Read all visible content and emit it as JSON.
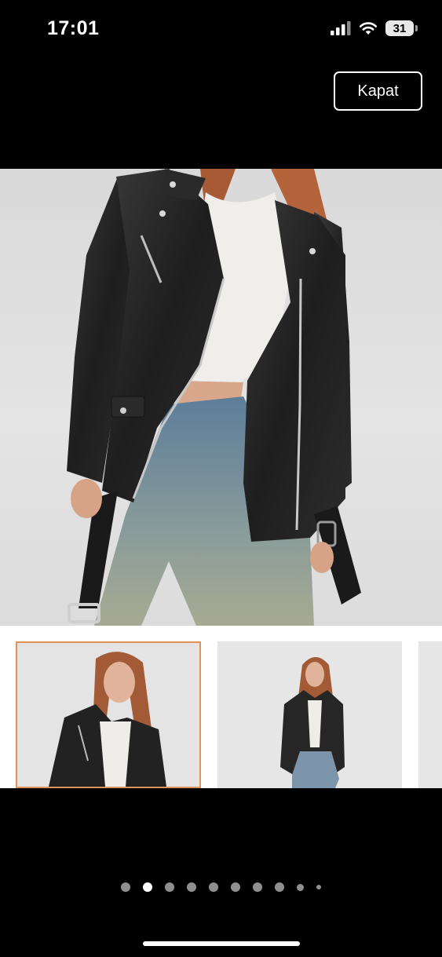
{
  "status_bar": {
    "time": "17:01",
    "battery_level": "31",
    "icons": [
      "cellular-signal-icon",
      "wifi-icon",
      "battery-icon"
    ]
  },
  "close_button": {
    "label": "Kapat"
  },
  "gallery": {
    "main_image": {
      "description_icon": "product-photo-leather-jacket"
    },
    "thumbnails": [
      {
        "name": "thumbnail-1",
        "selected": true
      },
      {
        "name": "thumbnail-2",
        "selected": false
      },
      {
        "name": "thumbnail-3",
        "selected": false
      }
    ],
    "page_count": 10,
    "active_page": 2
  },
  "colors": {
    "background": "#000000",
    "selected_thumb_border": "#e0925a",
    "dot_active": "#ffffff",
    "dot_inactive": "#8f8f8f"
  }
}
